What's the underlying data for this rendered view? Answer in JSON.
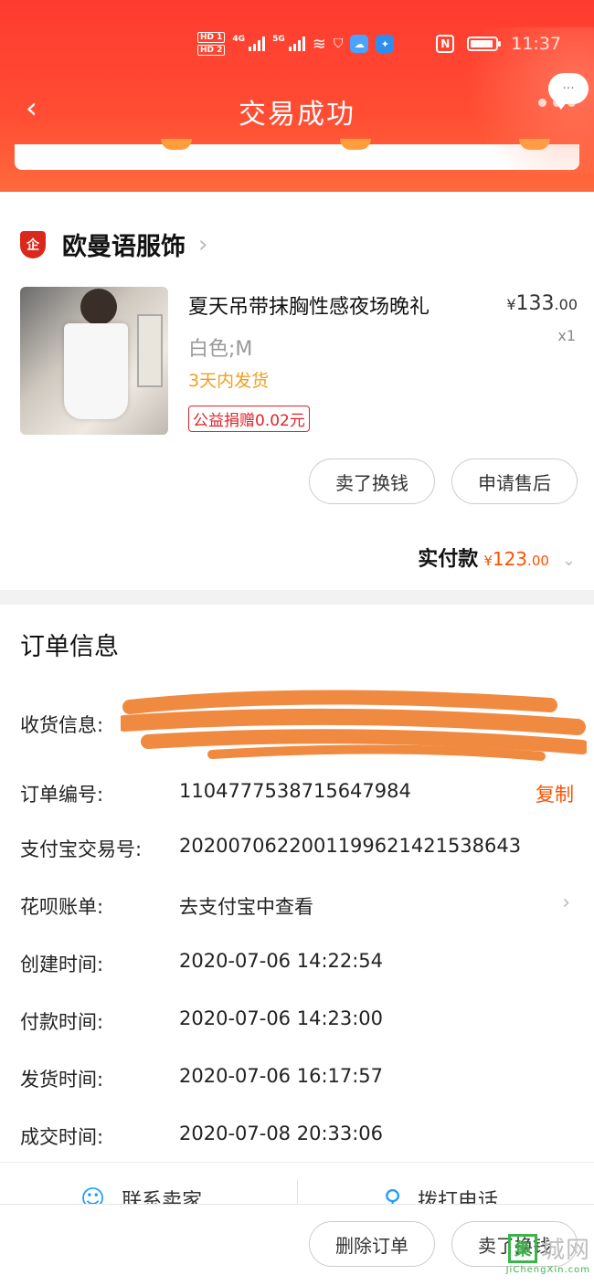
{
  "status_bar": {
    "hd1": "HD 1",
    "hd2": "HD 2",
    "net1": "4G",
    "net2": "5G",
    "nfc": "N",
    "time": "11:37"
  },
  "nav": {
    "title": "交易成功",
    "more_bubble": "···"
  },
  "shop": {
    "badge": "企",
    "name": "欧曼语服饰"
  },
  "product": {
    "title": "夏天吊带抹胸性感夜场晚礼",
    "price_currency": "¥",
    "price_int": "133",
    "price_dec": ".00",
    "quantity": "x1",
    "spec": "白色;M",
    "shipping": "3天内发货",
    "charity_tag": "公益捐赠0.02元"
  },
  "actions": {
    "sell_label": "卖了换钱",
    "after_sale_label": "申请售后",
    "delete_label": "删除订单",
    "sell_label_bottom": "卖了换钱"
  },
  "payment": {
    "label": "实付款",
    "currency": "¥",
    "amount_int": "123",
    "amount_dec": ".00"
  },
  "order_info": {
    "title": "订单信息",
    "rows": [
      {
        "label": "收货信息:",
        "value": ""
      },
      {
        "label": "订单编号:",
        "value": "1104777538715647984"
      },
      {
        "label": "支付宝交易号:",
        "value": "2020070622001199621421538643"
      },
      {
        "label": "花呗账单:",
        "value": "去支付宝中查看"
      },
      {
        "label": "创建时间:",
        "value": "2020-07-06 14:22:54"
      },
      {
        "label": "付款时间:",
        "value": "2020-07-06 14:23:00"
      },
      {
        "label": "发货时间:",
        "value": "2020-07-06 16:17:57"
      },
      {
        "label": "成交时间:",
        "value": "2020-07-08 20:33:06"
      }
    ],
    "copy_label": "复制"
  },
  "contact": {
    "seller_label": "联系卖家",
    "call_label": "拨打电话"
  },
  "watermark": {
    "box": "集",
    "cn": "城网",
    "en": "JiChengXin.com"
  },
  "colors": {
    "header_red": "#ff3b2f",
    "price_orange": "#ff5000",
    "shipping_yellow": "#f0a020",
    "tag_red": "#e0222a"
  }
}
